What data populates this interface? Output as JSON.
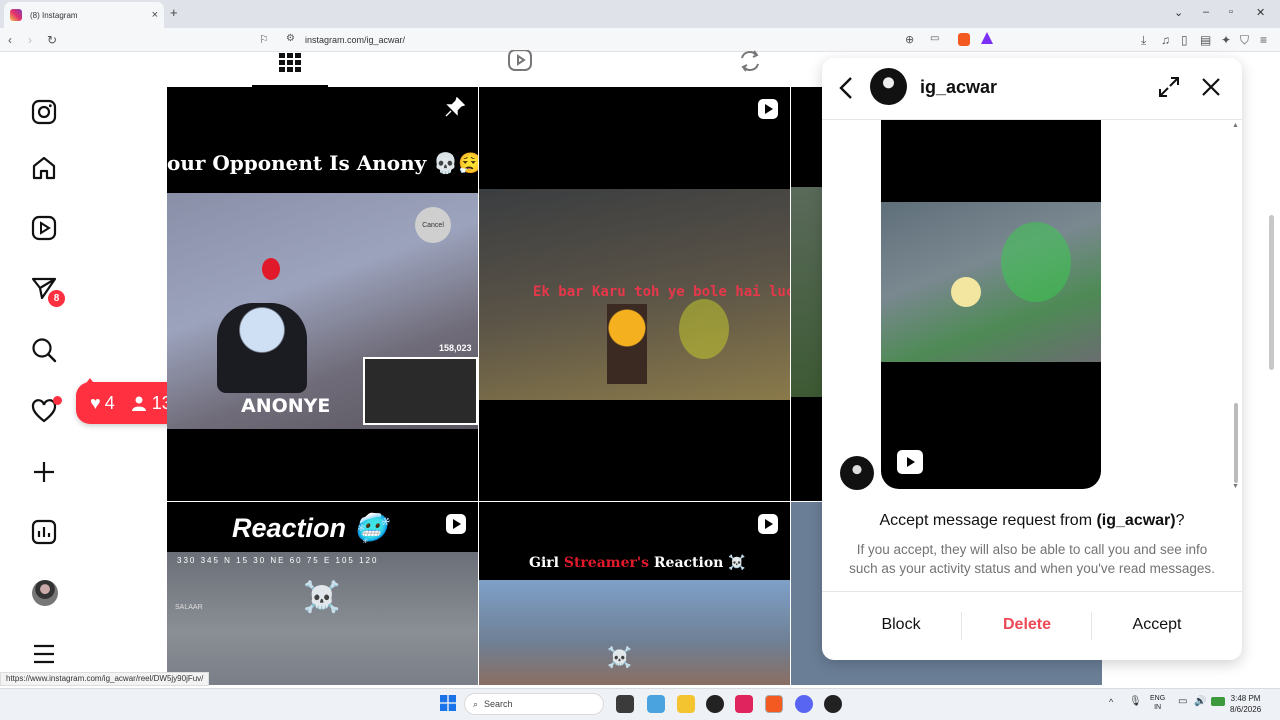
{
  "browser": {
    "tab_title": "(8) Instagram",
    "url": "instagram.com/ig_acwar/",
    "status_url": "https://www.instagram.com/ig_acwar/reel/DW5jy90jFuv/"
  },
  "rail": {
    "dm_badge": "8",
    "icons": [
      "instagram-icon",
      "home-icon",
      "reels-icon",
      "messages-icon",
      "search-icon",
      "heart-icon",
      "create-icon",
      "dashboard-icon",
      "profile-avatar",
      "menu-icon"
    ]
  },
  "notifications": {
    "likes": "4",
    "follows": "13"
  },
  "grid": {
    "tiles": [
      {
        "caption": "our Opponent Is Anony 💀😮‍💨",
        "views": "158,023",
        "overlay_text": "ANONYE",
        "button": "Cancel",
        "corner": "pin-icon"
      },
      {
        "caption": "Ek bar Karu toh ye bole hai luck",
        "corner": "reel-icon"
      },
      {
        "caption": "Reaction 🥶",
        "emoji": "☠️",
        "tag": "SALAAR",
        "compass": "330 345 N 15 30 NE 60 75 E 105 120",
        "corner": "reel-icon"
      },
      {
        "caption_a": "Girl ",
        "caption_b": "Streamer's",
        "caption_c": " Reaction ☠️",
        "emoji": "☠️",
        "corner": "reel-icon"
      }
    ]
  },
  "dm": {
    "username": "ig_acwar",
    "request_prefix": "Accept message request from ",
    "request_user": "(ig_acwar)",
    "request_suffix": "?",
    "request_body": "If you accept, they will also be able to call you and see info such as your activity status and when you've read messages.",
    "block": "Block",
    "delete": "Delete",
    "accept": "Accept",
    "delete_color": "#ed4956"
  },
  "taskbar": {
    "search": "Search",
    "lang": "ENG",
    "region": "IN",
    "time": "3:48 PM",
    "date": "8/6/2026"
  }
}
